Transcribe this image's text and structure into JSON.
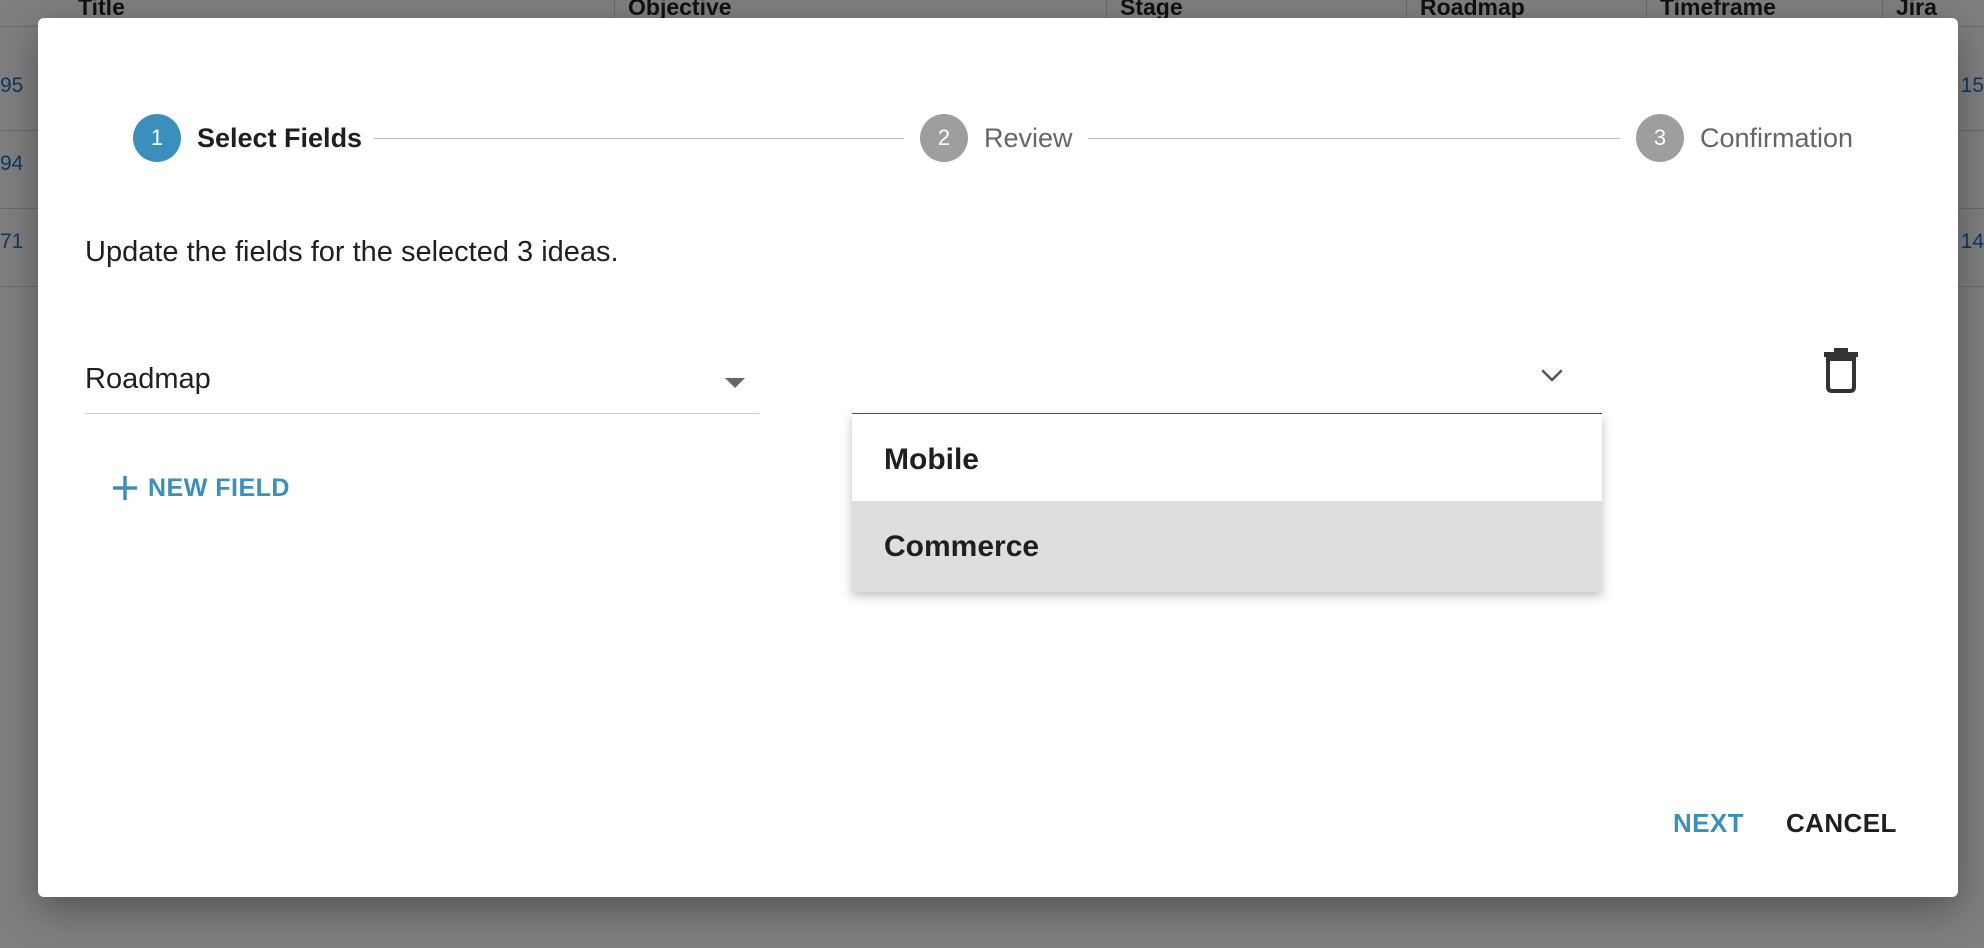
{
  "background": {
    "columns": [
      "Title",
      "Objective",
      "Stage",
      "Roadmap",
      "Timeframe",
      "Jira"
    ],
    "rows": [
      {
        "left": "95",
        "right": "15"
      },
      {
        "left": "94",
        "right": ""
      },
      {
        "left": "71",
        "right": "14"
      }
    ]
  },
  "dialog": {
    "stepper": [
      {
        "number": "1",
        "label": "Select Fields",
        "state": "active"
      },
      {
        "number": "2",
        "label": "Review",
        "state": "inactive"
      },
      {
        "number": "3",
        "label": "Confirmation",
        "state": "inactive"
      }
    ],
    "instructions": "Update the fields for the selected 3 ideas.",
    "field_select": {
      "value": "Roadmap"
    },
    "value_select": {
      "value": ""
    },
    "dropdown_options": [
      "Mobile",
      "Commerce"
    ],
    "highlighted_option": "Commerce",
    "new_field_label": "NEW FIELD",
    "buttons": {
      "next": "NEXT",
      "cancel": "CANCEL"
    }
  },
  "colors": {
    "accent": "#3b90b8",
    "step_active": "#3b8fbd",
    "step_inactive": "#9e9e9e",
    "link": "#1a73c8",
    "focus_underline": "#2c5f80"
  },
  "icons": [
    "chevron-down-icon",
    "trash-icon",
    "plus-icon",
    "caret-down-icon"
  ]
}
